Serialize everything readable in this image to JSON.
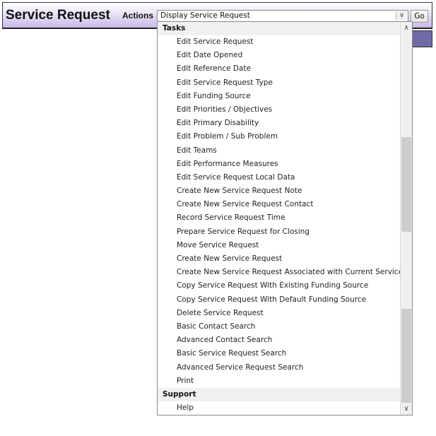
{
  "header": {
    "title": "Service Request",
    "actions_label": "Actions",
    "selected_action": "Display Service Request",
    "go_label": "Go"
  },
  "dropdown": {
    "groups": [
      {
        "label": "Tasks",
        "options": [
          "Edit Service Request",
          "Edit Date Opened",
          "Edit Reference Date",
          "Edit Service Request Type",
          "Edit Funding Source",
          "Edit Priorities / Objectives",
          "Edit Primary Disability",
          "Edit Problem / Sub Problem",
          "Edit Teams",
          "Edit Performance Measures",
          "Edit Service Request Local Data",
          "Create New Service Request Note",
          "Create New Service Request Contact",
          "Record Service Request Time",
          "Prepare Service Request for Closing",
          "Move Service Request",
          "Create New Service Request",
          "Create New Service Request Associated with Current Service Request",
          "Copy Service Request With Existing Funding Source",
          "Copy Service Request With Default Funding Source",
          "Delete Service Request",
          "Basic Contact Search",
          "Advanced Contact Search",
          "Basic Service Request Search",
          "Advanced Service Request Search",
          "Print"
        ]
      },
      {
        "label": "Support",
        "options": [
          "Help"
        ]
      }
    ],
    "scroll_up_icon": "^",
    "scroll_down_icon": "v"
  }
}
